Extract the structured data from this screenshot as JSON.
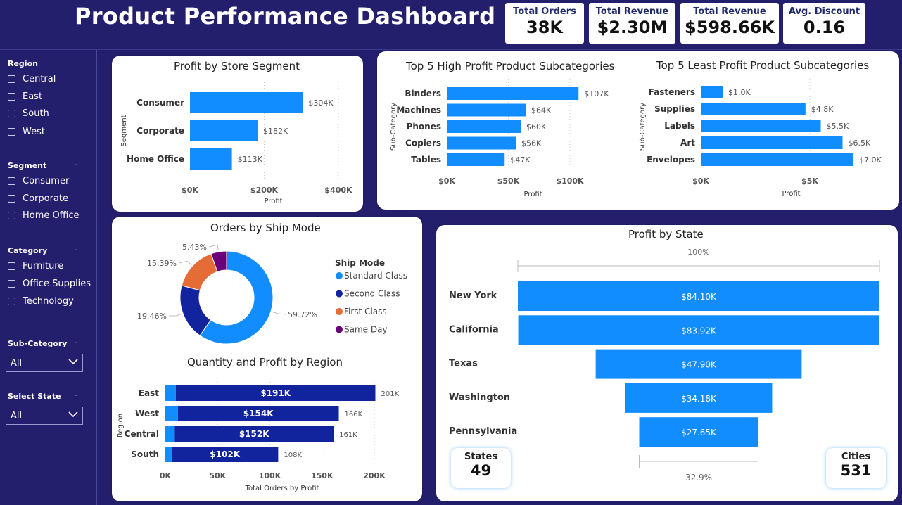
{
  "header": {
    "title": "Product Performance Dashboard"
  },
  "kpis": [
    {
      "label": "Total Orders",
      "value": "38K"
    },
    {
      "label": "Total Revenue",
      "value": "$2.30M"
    },
    {
      "label": "Total Revenue",
      "value": "$598.66K"
    },
    {
      "label": "Avg. Discount",
      "value": "0.16"
    }
  ],
  "sidebar": {
    "region": {
      "title": "Region",
      "items": [
        "Central",
        "East",
        "South",
        "West"
      ]
    },
    "segment": {
      "title": "Segment",
      "items": [
        "Consumer",
        "Corporate",
        "Home Office"
      ]
    },
    "category": {
      "title": "Category",
      "items": [
        "Furniture",
        "Office Supplies",
        "Technology"
      ]
    },
    "subcategory": {
      "title": "Sub-Category",
      "value": "All"
    },
    "state": {
      "title": "Select State",
      "value": "All"
    }
  },
  "colors": {
    "accent": "#118dff",
    "dark_blue": "#12239e",
    "orange": "#e66c37",
    "purple": "#6b007b",
    "background": "#241f6d"
  },
  "chart_data": [
    {
      "id": "segment",
      "type": "bar",
      "title": "Profit by Store Segment",
      "xlabel": "Profit",
      "ylabel": "Segment",
      "categories": [
        "Consumer",
        "Corporate",
        "Home Office"
      ],
      "values": [
        304,
        182,
        113
      ],
      "data_labels": [
        "$304K",
        "$182K",
        "$113K"
      ],
      "xticks": [
        "$0K",
        "$200K",
        "$400K"
      ],
      "xlim": [
        0,
        400
      ]
    },
    {
      "id": "top5",
      "type": "bar",
      "title": "Top 5 High Profit Product Subcategories",
      "xlabel": "Profit",
      "ylabel": "Sub-Category",
      "categories": [
        "Binders",
        "Machines",
        "Phones",
        "Copiers",
        "Tables"
      ],
      "values": [
        107,
        64,
        60,
        56,
        47
      ],
      "data_labels": [
        "$107K",
        "$64K",
        "$60K",
        "$56K",
        "$47K"
      ],
      "xticks": [
        "$0K",
        "$50K",
        "$100K"
      ],
      "xlim": [
        0,
        100
      ]
    },
    {
      "id": "least5",
      "type": "bar",
      "title": "Top 5 Least Profit Product Subcategories",
      "xlabel": "Profit",
      "ylabel": "Sub-Category",
      "categories": [
        "Fasteners",
        "Supplies",
        "Labels",
        "Art",
        "Envelopes"
      ],
      "values": [
        1.0,
        4.8,
        5.5,
        6.5,
        7.0
      ],
      "data_labels": [
        "$1.0K",
        "$4.8K",
        "$5.5K",
        "$6.5K",
        "$7.0K"
      ],
      "xticks": [
        "$0K",
        "$5K"
      ],
      "xlim": [
        0,
        5
      ]
    },
    {
      "id": "shipmode",
      "type": "pie",
      "title": "Orders by Ship Mode",
      "legend_title": "Ship Mode",
      "categories": [
        "Standard Class",
        "Second Class",
        "First Class",
        "Same Day"
      ],
      "values": [
        59.72,
        19.46,
        15.39,
        5.43
      ],
      "data_labels": [
        "59.72%",
        "19.46%",
        "15.39%",
        "5.43%"
      ],
      "colors": [
        "#118dff",
        "#12239e",
        "#e66c37",
        "#6b007b"
      ]
    },
    {
      "id": "region",
      "type": "bar",
      "title": "Quantity and Profit by Region",
      "xlabel": "Total Orders by Profit",
      "ylabel": "Region",
      "categories": [
        "East",
        "West",
        "Central",
        "South"
      ],
      "series": [
        {
          "values": [
            10,
            12,
            9,
            6
          ]
        },
        {
          "values": [
            191,
            154,
            152,
            102
          ]
        }
      ],
      "data_labels": [
        "$191K",
        "$154K",
        "$152K",
        "$102K"
      ],
      "total_labels": [
        "201K",
        "166K",
        "161K",
        "108K"
      ],
      "totals": [
        201,
        166,
        161,
        108
      ],
      "xticks": [
        "0K",
        "50K",
        "100K",
        "150K",
        "200K"
      ],
      "xlim": [
        0,
        200
      ]
    },
    {
      "id": "state",
      "type": "bar",
      "title": "Profit by State",
      "categories": [
        "New York",
        "California",
        "Texas",
        "Washington",
        "Pennsylvania"
      ],
      "values": [
        84.1,
        83.92,
        47.9,
        34.18,
        27.65
      ],
      "data_labels": [
        "$84.10K",
        "$83.92K",
        "$47.90K",
        "$34.18K",
        "$27.65K"
      ],
      "top_label": "100%",
      "bottom_label": "32.9%"
    }
  ],
  "mini_cards": {
    "states": {
      "label": "States",
      "value": "49"
    },
    "cities": {
      "label": "Cities",
      "value": "531"
    }
  }
}
